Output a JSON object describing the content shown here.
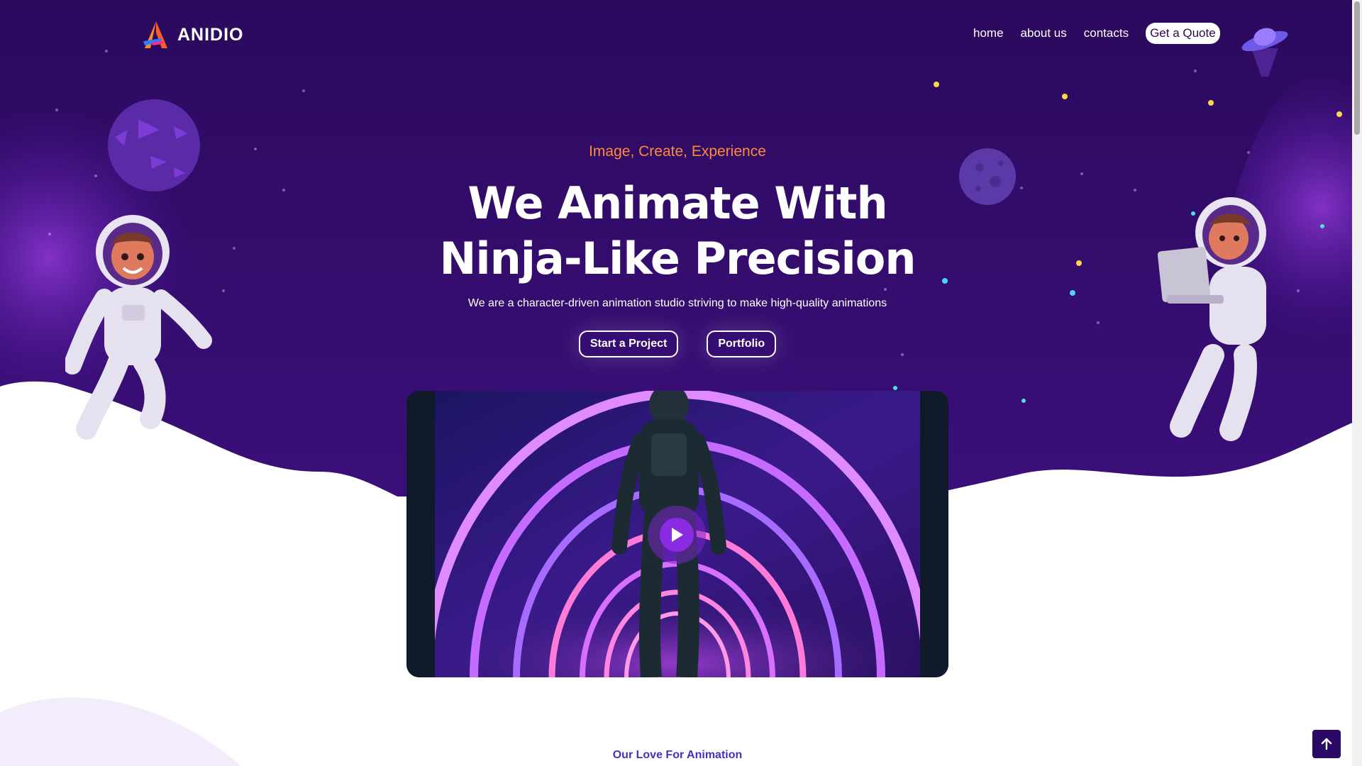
{
  "brand": {
    "name": "ANIDIO"
  },
  "nav": {
    "links": [
      "home",
      "about us",
      "contacts"
    ],
    "quote_label": "Get a Quote"
  },
  "hero": {
    "tagline": "Image, Create, Experience",
    "headline": "We Animate With Ninja-Like Precision",
    "subtext": "We are a character-driven animation studio striving to make high-quality animations",
    "primary_cta": "Start a Project",
    "secondary_cta": "Portfolio"
  },
  "video": {
    "play_icon": "play-icon"
  },
  "section": {
    "label": "Our Love For Animation"
  },
  "colors": {
    "purple_dark": "#2a075e",
    "purple_mid": "#5a1aa8",
    "purple_light": "#8b35d0",
    "accent_orange": "#ff8a3d",
    "section_label": "#4b2dbf"
  },
  "icons": [
    "logo-icon",
    "ufo-icon",
    "planet-icon",
    "moon-icon",
    "astronaut-icon",
    "astronaut-laptop-icon",
    "arrow-up-icon"
  ]
}
